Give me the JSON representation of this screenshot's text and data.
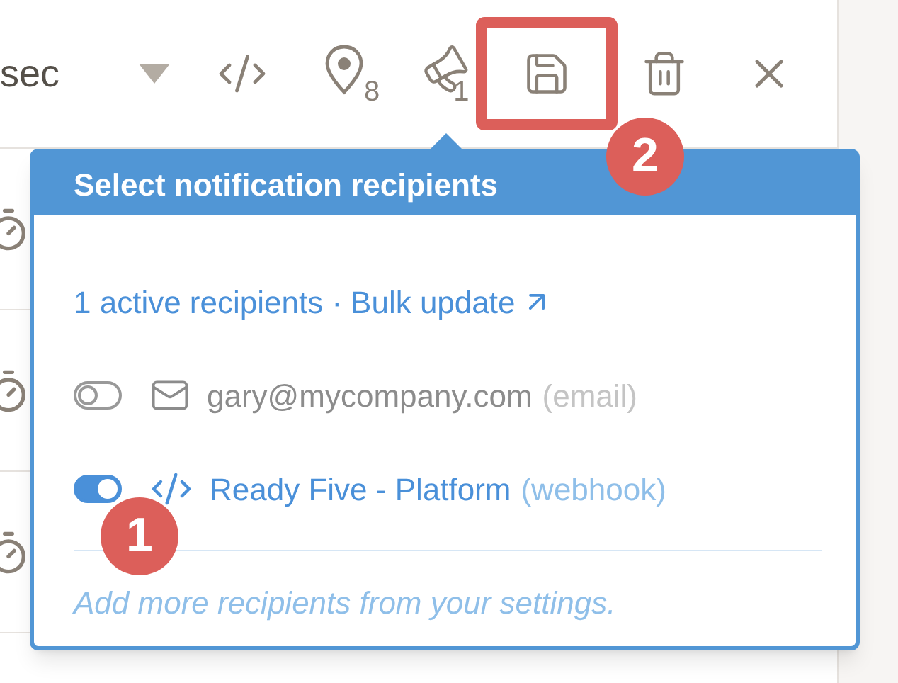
{
  "toolbar": {
    "title": "sec",
    "location_count": "8",
    "notification_count": "1",
    "save_highlighted": true
  },
  "popover": {
    "title": "Select notification recipients",
    "summary": "1 active recipients ·",
    "bulk_link": "Bulk update",
    "recipients": [
      {
        "kind": "email",
        "name": "gary@mycompany.com",
        "type_label": "(email)",
        "on": false
      },
      {
        "kind": "webhook",
        "name": "Ready Five - Platform",
        "type_label": "(webhook)",
        "on": true
      }
    ],
    "footer": "Add more recipients from your settings."
  },
  "annotations": [
    {
      "label": "1"
    },
    {
      "label": "2"
    }
  ]
}
